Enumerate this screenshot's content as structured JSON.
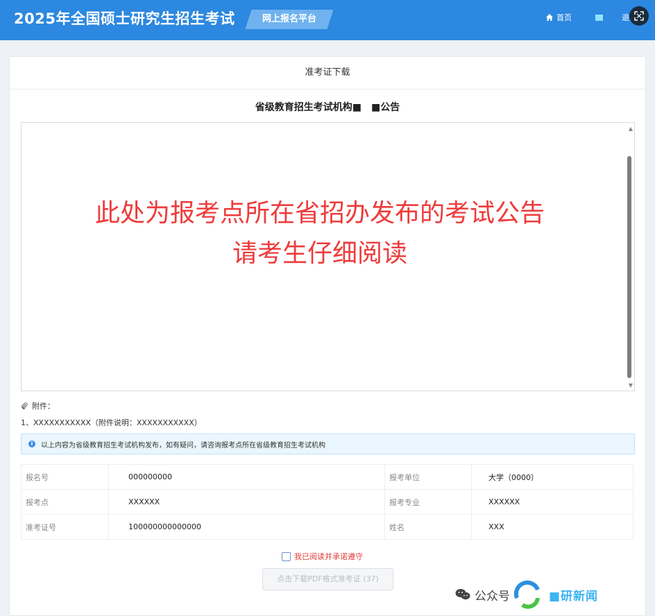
{
  "header": {
    "app_title": "2025年全国硕士研究生招生考试",
    "platform": "网上报名平台",
    "home_label": "首页",
    "logout_label": "退出"
  },
  "card": {
    "title": "准考证下载",
    "notice_title": "省级教育招生考试机构■　■公告",
    "notice_line1": "此处为报考点所在省招办发布的考试公告",
    "notice_line2": "请考生仔细阅读"
  },
  "attachments": {
    "heading": "附件：",
    "items": [
      "1、XXXXXXXXXXX（附件说明：XXXXXXXXXXX）"
    ]
  },
  "info_bar": {
    "text": "以上内容为省级教育招生考试机构发布，如有疑问，请咨询报考点所在省级教育招生考试机构"
  },
  "exam_info": {
    "rows": [
      {
        "label1": "报名号",
        "value1": "000000000",
        "label2": "报考单位",
        "value2": "大学（0000）"
      },
      {
        "label1": "报考点",
        "value1": "XXXXXX",
        "label2": "报考专业",
        "value2": "XXXXXX"
      },
      {
        "label1": "准考证号",
        "value1": "100000000000000",
        "label2": "姓名",
        "value2": "XXX"
      }
    ]
  },
  "agreement": {
    "label": "我已阅读并承诺遵守"
  },
  "download": {
    "label": "点击下载PDF格式准考证 (37)"
  },
  "watermark": {
    "text": "公众号",
    "brand": "■研新闻"
  },
  "colors": {
    "header_bg": "#2c88e0",
    "notice_red": "#ee3b3b",
    "agree_red": "#e03c3c"
  }
}
